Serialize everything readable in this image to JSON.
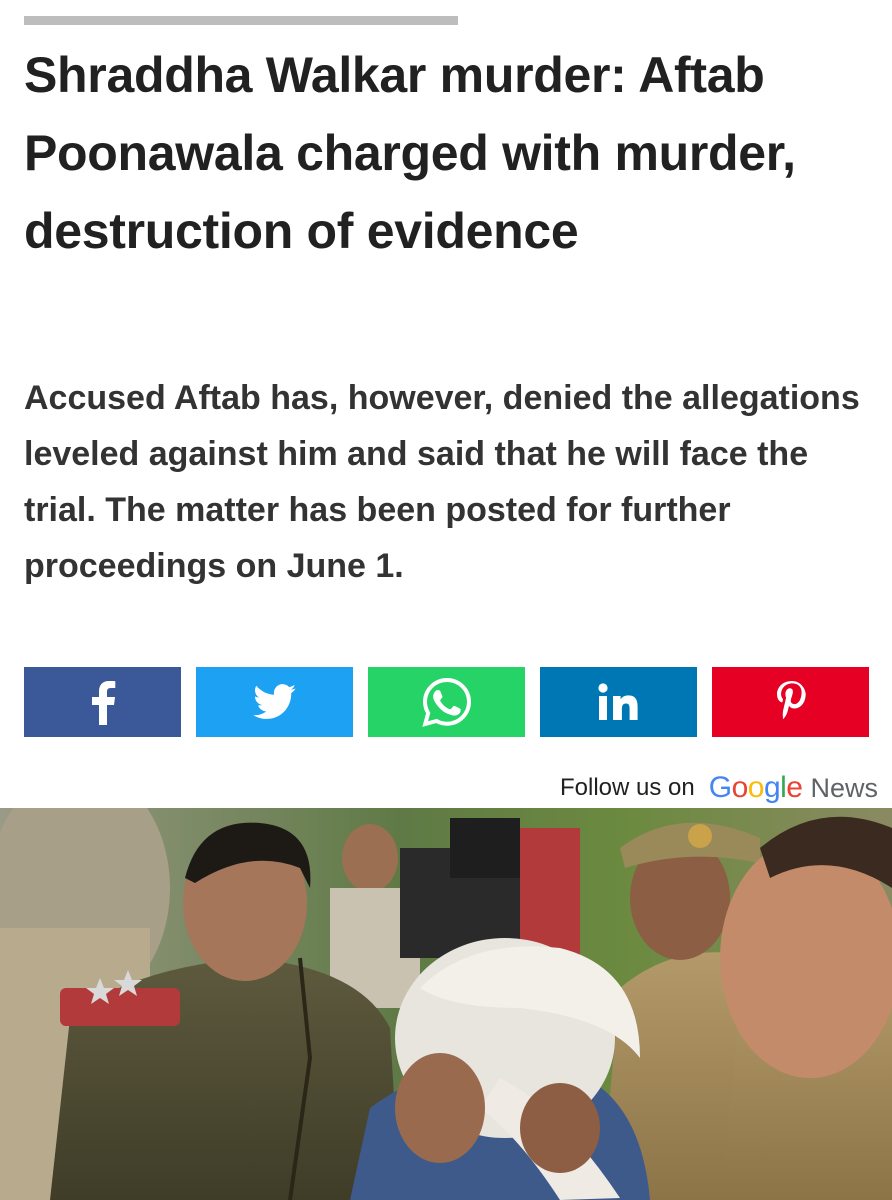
{
  "article": {
    "headline": "Shraddha Walkar murder: Aftab Poonawala charged with murder, destruction of evidence",
    "summary": "Accused Aftab has, however, denied the allegations leveled against him and said that he will face the trial. The matter has been posted for further proceedings on June 1."
  },
  "share": {
    "buttons": [
      {
        "name": "facebook",
        "icon": "facebook-icon",
        "color": "#3b5998"
      },
      {
        "name": "twitter",
        "icon": "twitter-icon",
        "color": "#1da1f2"
      },
      {
        "name": "whatsapp",
        "icon": "whatsapp-icon",
        "color": "#25d366"
      },
      {
        "name": "linkedin",
        "icon": "linkedin-icon",
        "color": "#0077b5"
      },
      {
        "name": "pinterest",
        "icon": "pinterest-icon",
        "color": "#e60023"
      }
    ]
  },
  "follow": {
    "label": "Follow us on",
    "google_letters": [
      "G",
      "o",
      "o",
      "g",
      "l",
      "e"
    ],
    "google_colors": [
      "#4285f4",
      "#ea4335",
      "#fbbc05",
      "#4285f4",
      "#34a853",
      "#ea4335"
    ],
    "news_label": "News"
  },
  "photo": {
    "description_icon": "news-photo"
  }
}
